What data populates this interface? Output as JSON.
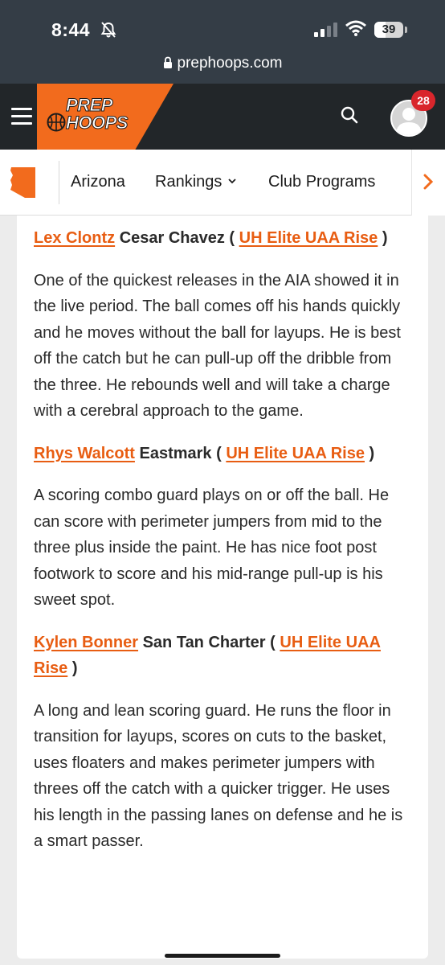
{
  "status_bar": {
    "time": "8:44",
    "battery": "39",
    "battery_level": 0.39
  },
  "browser": {
    "url": "prephoops.com"
  },
  "site_header": {
    "logo_line1": "PREP",
    "logo_line2": "HOOPS",
    "notification_count": "28"
  },
  "subnav": {
    "items": [
      {
        "label": "Arizona"
      },
      {
        "label": "Rankings"
      },
      {
        "label": "Club Programs"
      }
    ]
  },
  "article": {
    "players": [
      {
        "name": "Lex Clontz",
        "school": "Cesar Chavez (",
        "team": "UH Elite UAA Rise",
        "close": ")",
        "description": "One of the quickest releases in the AIA showed it in the live period. The ball comes off his hands quickly and he moves without the ball for layups. He is best off the catch but he can pull-up off the dribble from the three. He rebounds well and will take a charge with a cerebral approach to the game."
      },
      {
        "name": "Rhys Walcott",
        "school": "Eastmark (",
        "team": "UH Elite UAA Rise",
        "close": ")",
        "description": "A scoring combo guard plays on or off the ball. He can score with perimeter jumpers from mid to the three plus inside the paint. He has nice foot post footwork to score and his mid-range pull-up is his sweet spot."
      },
      {
        "name": "Kylen Bonner",
        "school": "San Tan Charter (",
        "team": "UH Elite UAA Rise",
        "close": ")",
        "description": "A long and lean scoring guard. He runs the floor in transition for layups, scores on cuts to the basket, uses floaters and makes perimeter jumpers with threes off the catch with a quicker trigger. He uses his length in the passing lanes on defense and he is a smart passer."
      }
    ]
  },
  "colors": {
    "brand_orange": "#f26b1d",
    "link_orange": "#e85d12",
    "header_dark": "#222629",
    "browser_bar": "#343d46",
    "badge_red": "#d9262c"
  },
  "icons": [
    "bell-slash-icon",
    "signal-icon",
    "wifi-icon",
    "lock-icon",
    "hamburger-menu-icon",
    "basketball-icon",
    "search-icon",
    "user-avatar-icon",
    "arizona-state-icon",
    "chevron-down-icon",
    "chevron-right-icon"
  ]
}
